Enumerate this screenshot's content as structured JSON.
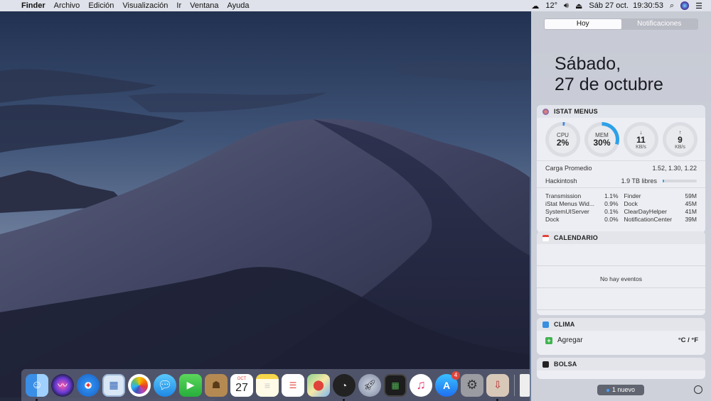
{
  "menubar": {
    "apple": "",
    "app_name": "Finder",
    "menus": [
      "Archivo",
      "Edición",
      "Visualización",
      "Ir",
      "Ventana",
      "Ayuda"
    ],
    "temperature": "12°",
    "datetime": "Sáb 27 oct.  19:30:53"
  },
  "notification_center": {
    "tabs": [
      "Hoy",
      "Notificaciones"
    ],
    "active_tab": "Hoy",
    "date_line1": "Sábado,",
    "date_line2": "27 de octubre",
    "istat": {
      "title": "ISTAT MENUS",
      "cpu_label": "CPU",
      "cpu_value": "2%",
      "mem_label": "MEM",
      "mem_value": "30%",
      "down_value": "11",
      "down_unit": "KB/s",
      "up_value": "9",
      "up_unit": "KB/s",
      "load_label": "Carga Promedio",
      "load_value": "1.52, 1.30, 1.22",
      "disk_label": "Hackintosh",
      "disk_value": "1.9 TB libres",
      "processes_cpu": [
        {
          "name": "Transmission",
          "value": "1.1%"
        },
        {
          "name": "iStat Menus Wid...",
          "value": "0.9%"
        },
        {
          "name": "SystemUIServer",
          "value": "0.1%"
        },
        {
          "name": "Dock",
          "value": "0.0%"
        }
      ],
      "processes_mem": [
        {
          "name": "Finder",
          "value": "59M"
        },
        {
          "name": "Dock",
          "value": "45M"
        },
        {
          "name": "ClearDayHelper",
          "value": "41M"
        },
        {
          "name": "NotificationCenter",
          "value": "39M"
        }
      ]
    },
    "calendar": {
      "title": "CALENDARIO",
      "empty": "No hay eventos"
    },
    "weather": {
      "title": "CLIMA",
      "add": "Agregar",
      "units": "°C / °F"
    },
    "stocks": {
      "title": "BOLSA"
    },
    "new_badge": "1 nuevo"
  },
  "dock": {
    "apps": [
      "Finder",
      "Siri",
      "Safari",
      "Vista previa",
      "Fotos",
      "Mensajes",
      "FaceTime",
      "Contactos",
      "Calendario",
      "Notas",
      "Recordatorios",
      "Mapas",
      "Monitor",
      "Launchpad",
      "Control de misión",
      "iTunes",
      "App Store",
      "Preferencias del Sistema",
      "Instalador",
      "Documento"
    ],
    "calendar_day": "27",
    "calendar_month": "OCT",
    "appstore_badge": "4"
  }
}
